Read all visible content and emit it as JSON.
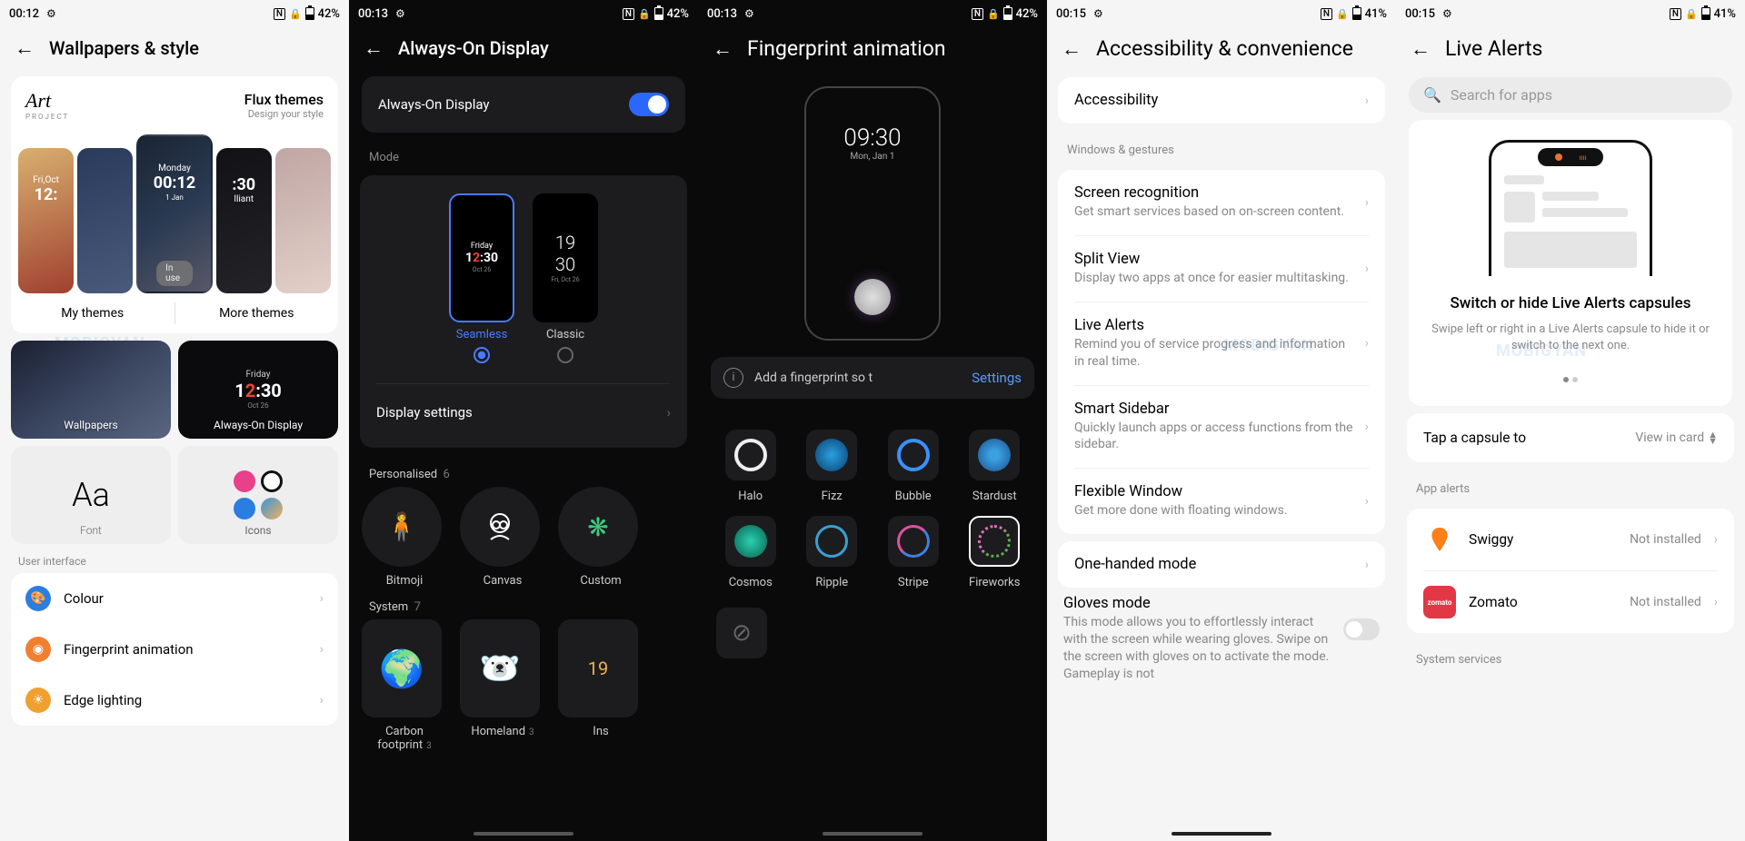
{
  "panel1": {
    "status": {
      "time": "00:12",
      "battery": "42%"
    },
    "title": "Wallpapers & style",
    "flux": {
      "logo": "Art",
      "logo_sub": "PROJECT",
      "title": "Flux themes",
      "sub": "Design your style"
    },
    "themes_center": {
      "day": "Monday",
      "time": "00:12",
      "date": "1 Jan"
    },
    "inuse": "In use",
    "my_themes": "My themes",
    "more_themes": "More themes",
    "tile_wallpapers": "Wallpapers",
    "tile_aod": "Always-On Display",
    "tile_aod_day": "Friday",
    "tile_aod_time": "12:30",
    "tile_aod_date": "Oct 26",
    "tile_font": "Font",
    "tile_font_glyph": "Aa",
    "tile_icons": "Icons",
    "sec_ui": "User interface",
    "li_colour": "Colour",
    "li_fp": "Fingerprint animation",
    "li_edge": "Edge lighting"
  },
  "panel2": {
    "status": {
      "time": "00:13",
      "battery": "42%"
    },
    "title": "Always-On Display",
    "aod_label": "Always-On Display",
    "mode_hdr": "Mode",
    "mode_seamless": "Seamless",
    "mode_classic": "Classic",
    "seamless_preview": {
      "day": "Friday",
      "time": "12:30",
      "date": "Oct 26"
    },
    "classic_preview": {
      "time_top": "19",
      "time_bot": "30",
      "date": "Fri, Oct 26"
    },
    "display_settings": "Display settings",
    "pers_hdr": "Personalised",
    "pers_count": "6",
    "pers": [
      "Bitmoji",
      "Canvas",
      "Custom"
    ],
    "sys_hdr": "System",
    "sys_count": "7",
    "sys": [
      {
        "name": "Carbon footprint",
        "count": "3"
      },
      {
        "name": "Homeland",
        "count": "3"
      },
      {
        "name": "Ins",
        "count": ""
      }
    ]
  },
  "panel3": {
    "status": {
      "time": "00:13",
      "battery": "42%"
    },
    "title": "Fingerprint animation",
    "preview_time": "09:30",
    "preview_date": "Mon, Jan 1",
    "info_text": "Add a fingerprint so t",
    "info_link": "Settings",
    "styles": [
      "Halo",
      "Fizz",
      "Bubble",
      "Stardust",
      "Cosmos",
      "Ripple",
      "Stripe",
      "Fireworks"
    ]
  },
  "panel4": {
    "status": {
      "time": "00:15",
      "battery": "41%"
    },
    "title": "Accessibility & convenience",
    "accessibility": "Accessibility",
    "sec_windows": "Windows & gestures",
    "items": [
      {
        "t": "Screen recognition",
        "s": "Get smart services based on on-screen content."
      },
      {
        "t": "Split View",
        "s": "Display two apps at once for easier multitasking."
      },
      {
        "t": "Live Alerts",
        "s": "Remind you of service progress and information in real time."
      },
      {
        "t": "Smart Sidebar",
        "s": "Quickly launch apps or access functions from the sidebar."
      },
      {
        "t": "Flexible Window",
        "s": "Get more done with floating windows."
      }
    ],
    "onehanded": "One-handed mode",
    "gloves_t": "Gloves mode",
    "gloves_s": "This mode allows you to effortlessly interact with the screen while wearing gloves. Swipe on the screen with gloves on to activate the mode. Gameplay is not"
  },
  "panel5": {
    "status": {
      "time": "00:15",
      "battery": "41%"
    },
    "title": "Live Alerts",
    "search_ph": "Search for apps",
    "hero_t": "Switch or hide Live Alerts capsules",
    "hero_s": "Swipe left or right in a Live Alerts capsule to hide it or switch to the next one.",
    "tap_label": "Tap a capsule to",
    "tap_value": "View in card",
    "sec_app": "App alerts",
    "apps": [
      {
        "name": "Swiggy",
        "status": "Not installed"
      },
      {
        "name": "Zomato",
        "status": "Not installed"
      }
    ],
    "sec_sys": "System services"
  },
  "watermark": "MOBIGYAN"
}
